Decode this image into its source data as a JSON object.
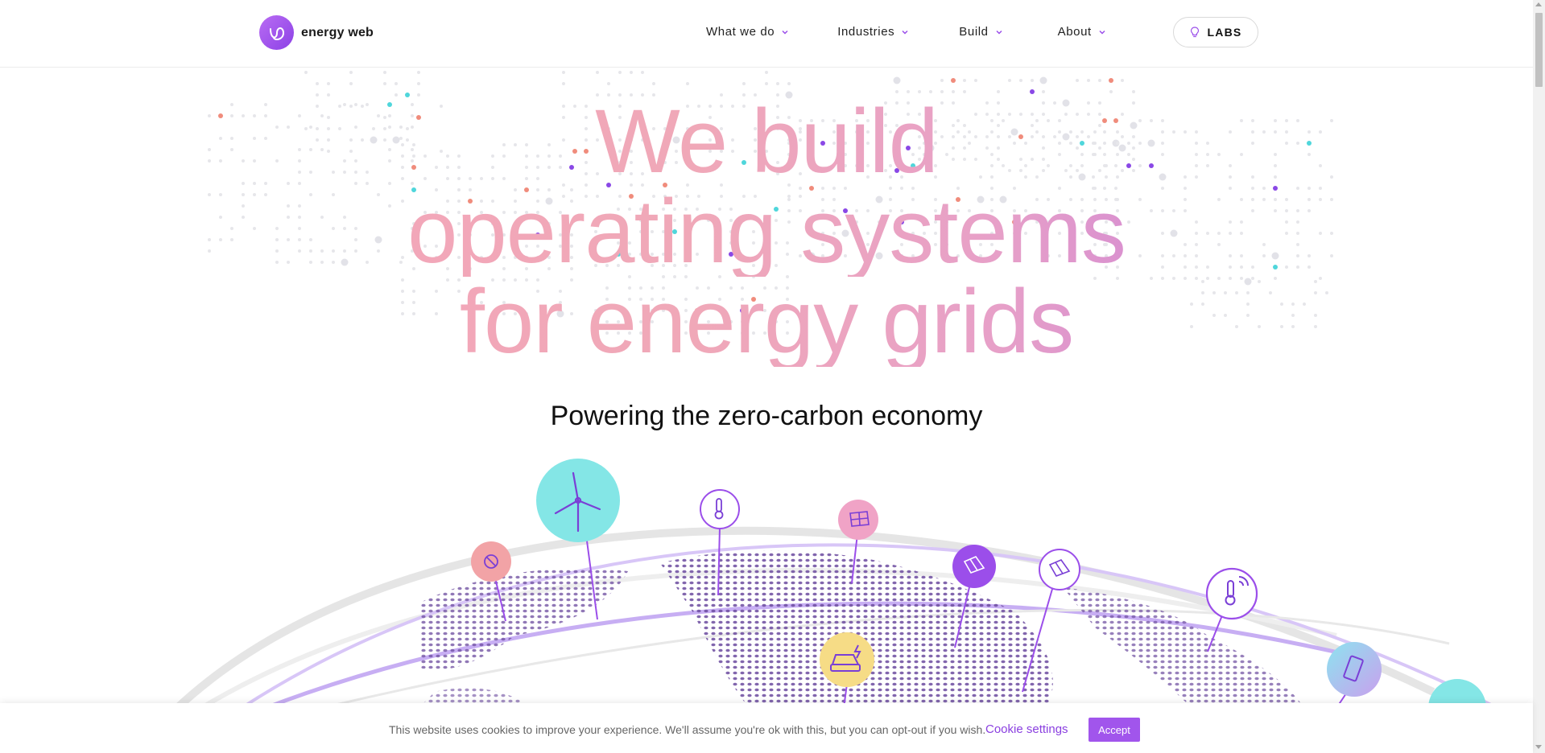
{
  "brand": {
    "name": "energy web",
    "accent": "#9b4eea"
  },
  "nav": {
    "items": [
      {
        "label": "What we do"
      },
      {
        "label": "Industries"
      },
      {
        "label": "Build"
      },
      {
        "label": "About"
      }
    ],
    "labs_label": "LABS"
  },
  "hero": {
    "title_lines": [
      "We build",
      "operating systems",
      "for energy grids"
    ],
    "subtitle": "Powering the zero-carbon economy",
    "gradient": [
      "#f5a5ba",
      "#b46ee0"
    ]
  },
  "globe_icons": [
    {
      "name": "wind-turbine-icon"
    },
    {
      "name": "charging-plug-icon"
    },
    {
      "name": "thermometer-icon"
    },
    {
      "name": "solar-panel-icon"
    },
    {
      "name": "solar-roof-icon"
    },
    {
      "name": "solar-roof-outline-icon"
    },
    {
      "name": "smart-thermometer-icon"
    },
    {
      "name": "electric-car-icon"
    },
    {
      "name": "battery-icon"
    },
    {
      "name": "wind-turbine-icon"
    }
  ],
  "cookie": {
    "text": "This website uses cookies to improve your experience. We'll assume you're ok with this, but you can opt-out if you wish.",
    "settings_label": "Cookie settings",
    "accept_label": "Accept"
  }
}
